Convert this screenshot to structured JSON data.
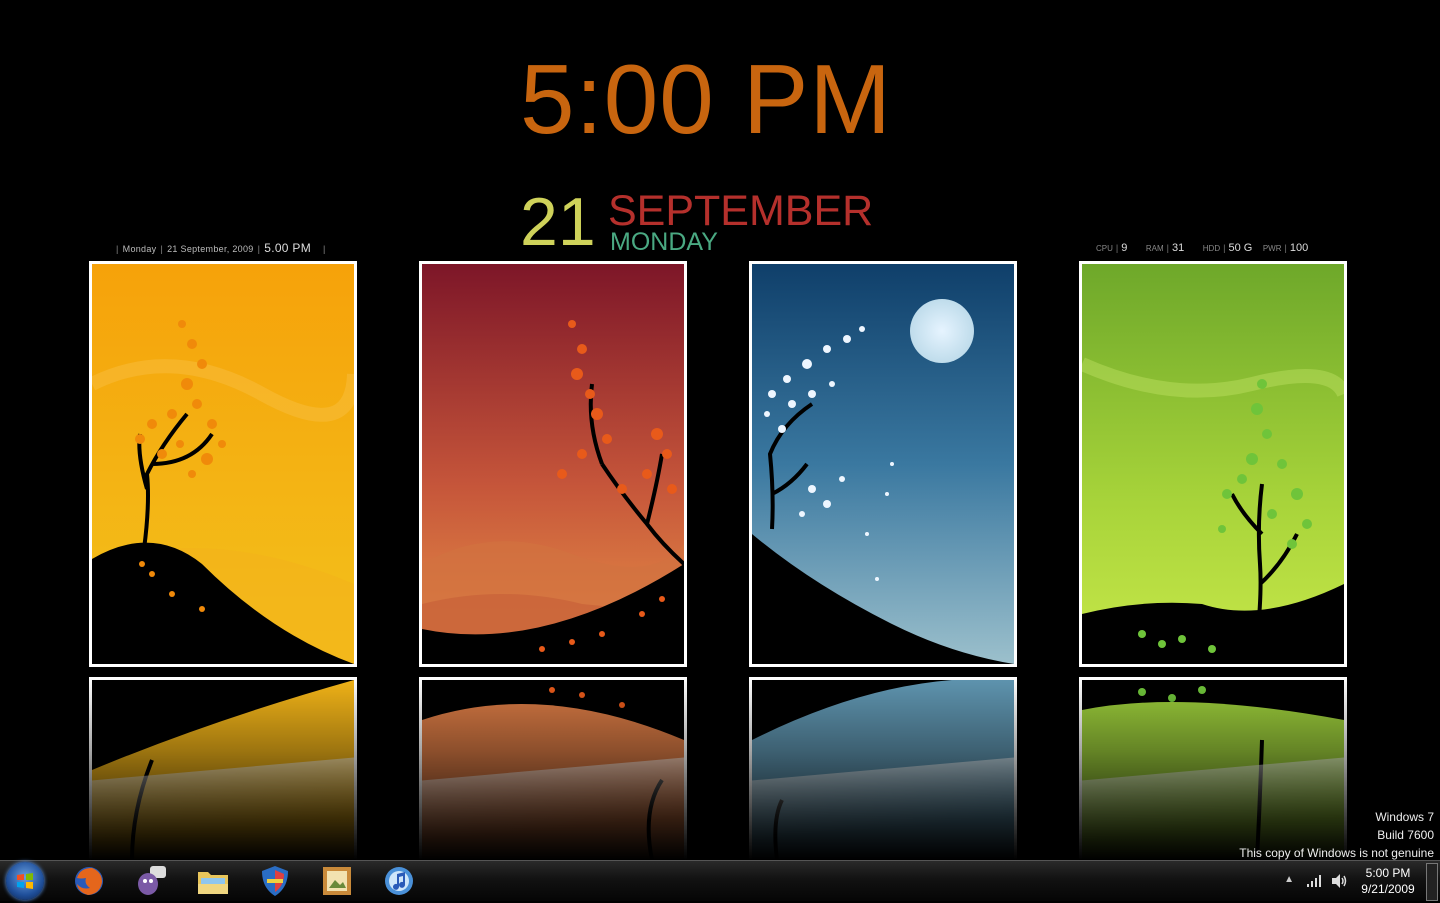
{
  "clock": {
    "time": "5:00 PM",
    "day_number": "21",
    "month": "SEPTEMBER",
    "weekday": "MONDAY"
  },
  "date_bar": {
    "day": "Monday",
    "date": "21 September, 2009",
    "time": "5.00 PM"
  },
  "system_monitor": {
    "cpu_label": "CPU",
    "cpu_value": "9",
    "ram_label": "RAM",
    "ram_value": "31",
    "hdd_label": "HDD",
    "hdd_value": "50 G",
    "pwr_label": "PWR",
    "pwr_value": "100"
  },
  "panels": [
    {
      "season": "autumn-gold",
      "colors": [
        "#f6a20a",
        "#f2c21c"
      ]
    },
    {
      "season": "autumn-red",
      "colors": [
        "#7d1628",
        "#e8803a"
      ]
    },
    {
      "season": "winter-night",
      "colors": [
        "#0f3f6a",
        "#8fb6c8"
      ]
    },
    {
      "season": "spring-green",
      "colors": [
        "#6ea82a",
        "#c8e84a"
      ]
    }
  ],
  "watermark": {
    "line1": "Windows 7",
    "line2": "Build 7600",
    "line3": "This copy of Windows is not genuine"
  },
  "taskbar": {
    "start_icon": "windows-orb-icon",
    "pinned": [
      {
        "name": "firefox-icon",
        "color": "#e5661c"
      },
      {
        "name": "pidgin-icon",
        "color": "#7b5aa6"
      },
      {
        "name": "explorer-folder-icon",
        "color": "#e8c55a"
      },
      {
        "name": "security-shield-icon",
        "color": "#2a6dc4"
      },
      {
        "name": "photo-app-icon",
        "color": "#c98a3a"
      },
      {
        "name": "itunes-icon",
        "color": "#4a90d8"
      }
    ],
    "tray": {
      "time": "5:00 PM",
      "date": "9/21/2009",
      "up_arrow": "▲"
    }
  }
}
